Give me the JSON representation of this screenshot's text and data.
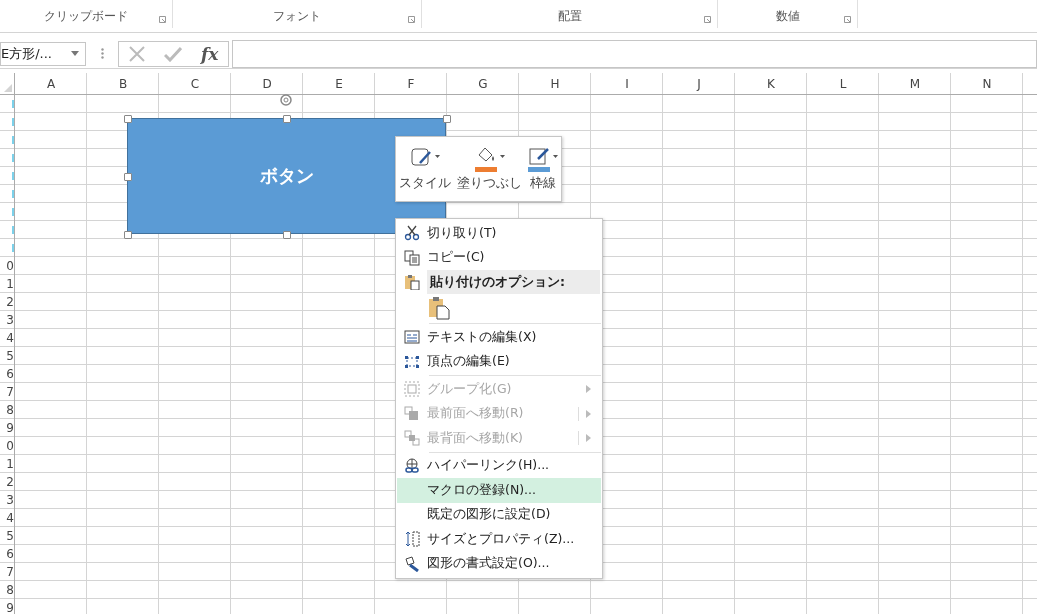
{
  "ribbon": {
    "groups": [
      {
        "label": "クリップボード"
      },
      {
        "label": "フォント"
      },
      {
        "label": "配置"
      },
      {
        "label": "数値"
      }
    ]
  },
  "formula_bar": {
    "name_box": "E方形/...",
    "fx": "fx"
  },
  "columns": [
    "A",
    "B",
    "C",
    "D",
    "E",
    "F",
    "G",
    "H",
    "I",
    "J",
    "K",
    "L",
    "M",
    "N"
  ],
  "rows": [
    {
      "label": "",
      "highlighted": true
    },
    {
      "label": "",
      "highlighted": true
    },
    {
      "label": "",
      "highlighted": true
    },
    {
      "label": "",
      "highlighted": true
    },
    {
      "label": "",
      "highlighted": true
    },
    {
      "label": "",
      "highlighted": true
    },
    {
      "label": "",
      "highlighted": true
    },
    {
      "label": "",
      "highlighted": true
    },
    {
      "label": "",
      "highlighted": true
    },
    {
      "label": "0",
      "highlighted": false
    },
    {
      "label": "1",
      "highlighted": false
    },
    {
      "label": "2",
      "highlighted": false
    },
    {
      "label": "3",
      "highlighted": false
    },
    {
      "label": "4",
      "highlighted": false
    },
    {
      "label": "5",
      "highlighted": false
    },
    {
      "label": "6",
      "highlighted": false
    },
    {
      "label": "7",
      "highlighted": false
    },
    {
      "label": "8",
      "highlighted": false
    },
    {
      "label": "9",
      "highlighted": false
    },
    {
      "label": "0",
      "highlighted": false
    },
    {
      "label": "1",
      "highlighted": false
    },
    {
      "label": "2",
      "highlighted": false
    },
    {
      "label": "3",
      "highlighted": false
    },
    {
      "label": "4",
      "highlighted": false
    },
    {
      "label": "5",
      "highlighted": false
    },
    {
      "label": "6",
      "highlighted": false
    },
    {
      "label": "7",
      "highlighted": false
    },
    {
      "label": "8",
      "highlighted": false
    },
    {
      "label": "9",
      "highlighted": false
    }
  ],
  "shape": {
    "text": "ボタン",
    "selected": true
  },
  "mini_toolbar": [
    {
      "label": "スタイル"
    },
    {
      "label": "塗りつぶし",
      "color": "#ed7d31"
    },
    {
      "label": "枠線",
      "color": "#5b9bd5"
    }
  ],
  "context_menu": [
    {
      "kind": "item",
      "label": "切り取り(T)",
      "disabled": false,
      "selected": false,
      "submenu": false
    },
    {
      "kind": "item",
      "label": "コピー(C)",
      "disabled": false,
      "selected": false,
      "submenu": false
    },
    {
      "kind": "header",
      "label": "貼り付けのオプション:"
    },
    {
      "kind": "paste"
    },
    {
      "kind": "separator"
    },
    {
      "kind": "item",
      "label": "テキストの編集(X)",
      "disabled": false,
      "selected": false,
      "submenu": false
    },
    {
      "kind": "item",
      "label": "頂点の編集(E)",
      "disabled": false,
      "selected": false,
      "submenu": false
    },
    {
      "kind": "separator"
    },
    {
      "kind": "item",
      "label": "グループ化(G)",
      "disabled": true,
      "selected": false,
      "submenu": true
    },
    {
      "kind": "item",
      "label": "最前面へ移動(R)",
      "disabled": true,
      "selected": false,
      "submenu": true,
      "split": true
    },
    {
      "kind": "item",
      "label": "最背面へ移動(K)",
      "disabled": true,
      "selected": false,
      "submenu": true,
      "split": true
    },
    {
      "kind": "separator"
    },
    {
      "kind": "item",
      "label": "ハイパーリンク(H)...",
      "disabled": false,
      "selected": false,
      "submenu": false
    },
    {
      "kind": "item",
      "label": "マクロの登録(N)...",
      "disabled": false,
      "selected": true,
      "submenu": false
    },
    {
      "kind": "item",
      "label": "既定の図形に設定(D)",
      "disabled": false,
      "selected": false,
      "submenu": false
    },
    {
      "kind": "item",
      "label": "サイズとプロパティ(Z)...",
      "disabled": false,
      "selected": false,
      "submenu": false
    },
    {
      "kind": "item",
      "label": "図形の書式設定(O)...",
      "disabled": false,
      "selected": false,
      "submenu": false
    }
  ]
}
